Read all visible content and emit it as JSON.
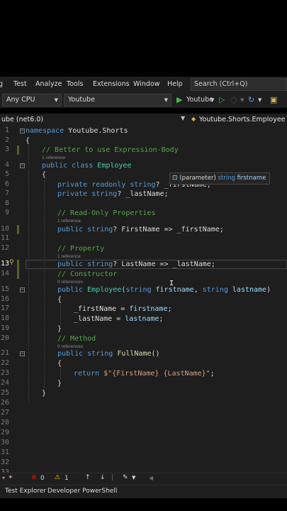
{
  "menu": {
    "items": [
      "g",
      "Test",
      "Analyze",
      "Tools",
      "Extensions",
      "Window",
      "Help"
    ],
    "search_placeholder": "Search (Ctrl+Q)"
  },
  "toolbar": {
    "platform": "Any CPU",
    "project": "Youtube",
    "run_target": "Youtube"
  },
  "navbar": {
    "project_scope": "ube (net6.0)",
    "type_scope": "Youtube.Shorts.Employee"
  },
  "editor": {
    "active_line": 13,
    "line_numbers": [
      "1",
      "2",
      "3",
      "4",
      "5",
      "6",
      "7",
      "8",
      "9",
      "10",
      "11",
      "12",
      "13",
      "14",
      "15",
      "16",
      "17",
      "18",
      "19",
      "20",
      "21",
      "22",
      "23",
      "24",
      "25",
      "26",
      "27",
      "28",
      "29",
      "30",
      "31",
      "32",
      "33"
    ],
    "codelens": {
      "l4": "1 reference",
      "l10": "1 reference",
      "l13": "1 reference",
      "l15": "0 references",
      "l21": "0 references"
    },
    "lines": {
      "l1": {
        "kw": "namespace",
        "name": "Youtube.Shorts"
      },
      "l2": "{",
      "l3": "// Better to use Expression-Body",
      "l4": {
        "kw1": "public",
        "kw2": "class",
        "name": "Employee"
      },
      "l5": "{",
      "l6": {
        "kw1": "private",
        "kw2": "readonly",
        "kw3": "string",
        "rest": "? _firstName;"
      },
      "l7": {
        "kw1": "private",
        "kw2": "string",
        "rest": "? _lastName;"
      },
      "l9": "// Read-Only Properties",
      "l10": {
        "kw1": "public",
        "kw2": "string",
        "rest": "? FirstName => _firstName;"
      },
      "l12": "// Property",
      "l13": {
        "kw1": "public",
        "kw2": "string",
        "rest": "? LastName => _lastName;"
      },
      "l14": "// Constructor",
      "l15": {
        "kw1": "public",
        "name": "Employee",
        "open": "(",
        "kw2": "string",
        "p1": "firstname",
        "comma": ", ",
        "kw3": "string",
        "p2": "lastname",
        "close": ")"
      },
      "l16": "{",
      "l17": {
        "field": "_firstName",
        "eq": " = ",
        "param": "firstname",
        "semi": ";"
      },
      "l18": {
        "field": "_lastName",
        "eq": " = ",
        "param": "lastname",
        "semi": ";"
      },
      "l19": "}",
      "l20": "// Method",
      "l21": {
        "kw1": "public",
        "kw2": "string",
        "name": "FullName",
        "rest": "()"
      },
      "l22": "{",
      "l23": {
        "kw": "return",
        "str": "$\"{FirstName} {LastName}\"",
        "semi": ";"
      },
      "l24": "}",
      "l25": "}"
    }
  },
  "tooltip": {
    "kind": "(parameter)",
    "type": "string",
    "name": "firstname"
  },
  "status": {
    "errors": "0",
    "warnings": "1"
  },
  "bottom_tabs": [
    "Test Explorer",
    "Developer PowerShell"
  ],
  "colors": {
    "keyword": "#569cd6",
    "type": "#4ec9b0",
    "comment": "#57a64a",
    "string": "#d69d85",
    "method": "#dcdcaa",
    "accent_run": "#3fb950",
    "error": "#e51400",
    "warning": "#ffcc00"
  }
}
